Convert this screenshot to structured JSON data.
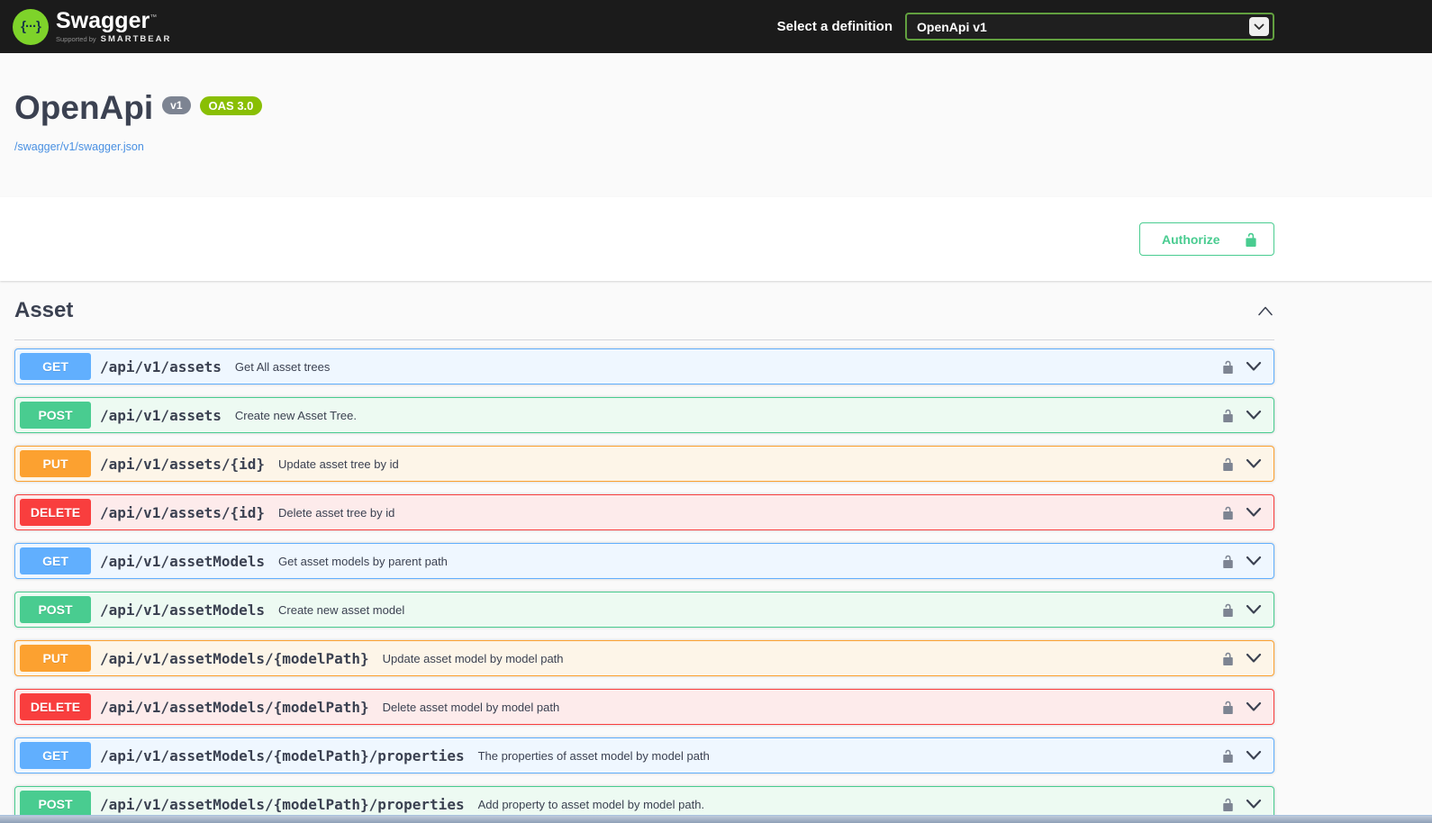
{
  "topbar": {
    "brand": "Swagger",
    "brand_tm": "™",
    "logo_glyph": "{···}",
    "tagline_prefix": "Supported by",
    "tagline_brand": "SMARTBEAR",
    "definition_label": "Select a definition",
    "definition_value": "OpenApi v1"
  },
  "info": {
    "title": "OpenApi",
    "version_badge": "v1",
    "oas_badge": "OAS 3.0",
    "spec_url": "/swagger/v1/swagger.json"
  },
  "scheme": {
    "authorize_label": "Authorize"
  },
  "tag_section": {
    "title": "Asset"
  },
  "operations": [
    {
      "method": "GET",
      "path": "/api/v1/assets",
      "summary": "Get All asset trees"
    },
    {
      "method": "POST",
      "path": "/api/v1/assets",
      "summary": "Create new Asset Tree."
    },
    {
      "method": "PUT",
      "path": "/api/v1/assets/{id}",
      "summary": "Update asset tree by id"
    },
    {
      "method": "DELETE",
      "path": "/api/v1/assets/{id}",
      "summary": "Delete asset tree by id"
    },
    {
      "method": "GET",
      "path": "/api/v1/assetModels",
      "summary": "Get asset models by parent path"
    },
    {
      "method": "POST",
      "path": "/api/v1/assetModels",
      "summary": "Create new asset model"
    },
    {
      "method": "PUT",
      "path": "/api/v1/assetModels/{modelPath}",
      "summary": "Update asset model by model path"
    },
    {
      "method": "DELETE",
      "path": "/api/v1/assetModels/{modelPath}",
      "summary": "Delete asset model by model path"
    },
    {
      "method": "GET",
      "path": "/api/v1/assetModels/{modelPath}/properties",
      "summary": "The properties of asset model by model path"
    },
    {
      "method": "POST",
      "path": "/api/v1/assetModels/{modelPath}/properties",
      "summary": "Add property to asset model by model path."
    }
  ],
  "colors": {
    "topbar_bg": "#1b1b1b",
    "logo_green": "#7ed32a",
    "select_border_green": "#62a03f",
    "authorize_green": "#49cc90",
    "oas_badge_green": "#89bf04",
    "version_badge_gray": "#7d8492",
    "link_blue": "#4990e2",
    "text_dark": "#3b4151",
    "methods": {
      "GET": {
        "accent": "#61affe",
        "tint": "#eff7ff"
      },
      "POST": {
        "accent": "#49cc90",
        "tint": "#edfaf2"
      },
      "PUT": {
        "accent": "#fca130",
        "tint": "#fdf5e8"
      },
      "DELETE": {
        "accent": "#f93e3e",
        "tint": "#fdebeb"
      }
    }
  }
}
